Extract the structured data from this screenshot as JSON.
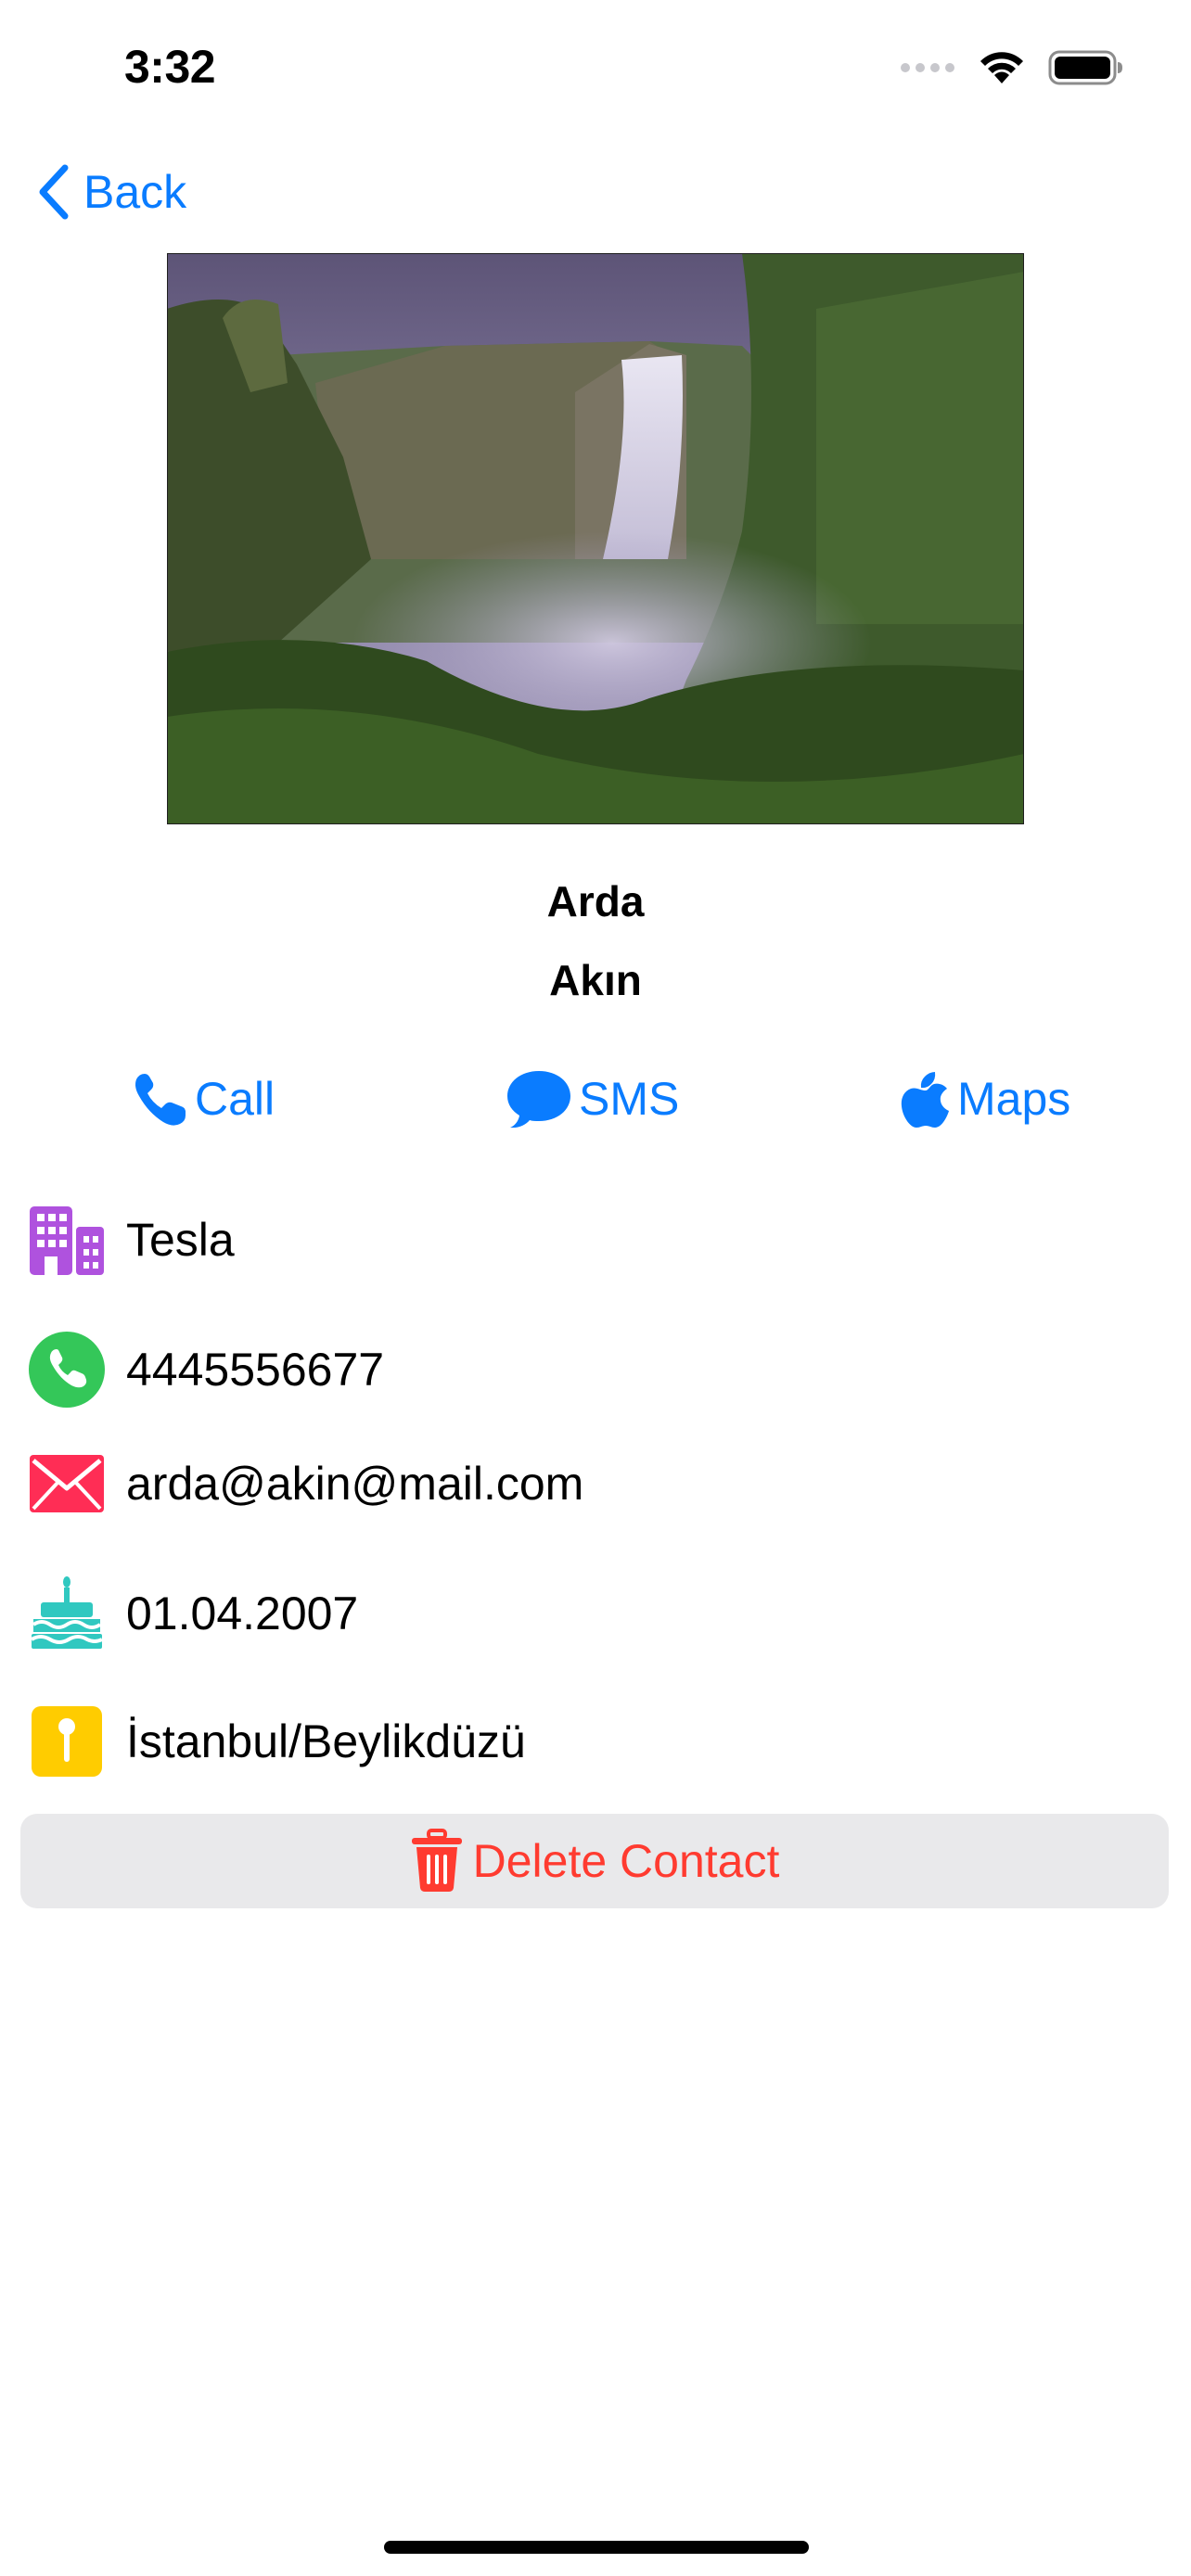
{
  "status_bar": {
    "time": "3:32"
  },
  "nav": {
    "back_label": "Back"
  },
  "contact": {
    "first_name": "Arda",
    "last_name": "Akın"
  },
  "actions": {
    "call_label": "Call",
    "sms_label": "SMS",
    "maps_label": "Maps"
  },
  "info": {
    "company": "Tesla",
    "phone": "4445556677",
    "email": "arda@akin@mail.com",
    "birthday": "01.04.2007",
    "address": "İstanbul/Beylikdüzü"
  },
  "delete": {
    "label": "Delete Contact"
  },
  "icons": {
    "company": "building-icon",
    "phone": "phone-circle-icon",
    "email": "envelope-icon",
    "birthday": "birthday-cake-icon",
    "address": "map-pin-icon",
    "call": "phone-icon",
    "sms": "message-bubble-icon",
    "maps": "apple-logo-icon",
    "delete": "trash-icon"
  },
  "colors": {
    "accent": "#0a7cff",
    "destructive": "#ff3b30",
    "company_icon": "#af52de",
    "phone_icon": "#34c759",
    "email_icon": "#ff2d55",
    "birthday_icon": "#30c8c0",
    "address_icon": "#ffcc00"
  }
}
